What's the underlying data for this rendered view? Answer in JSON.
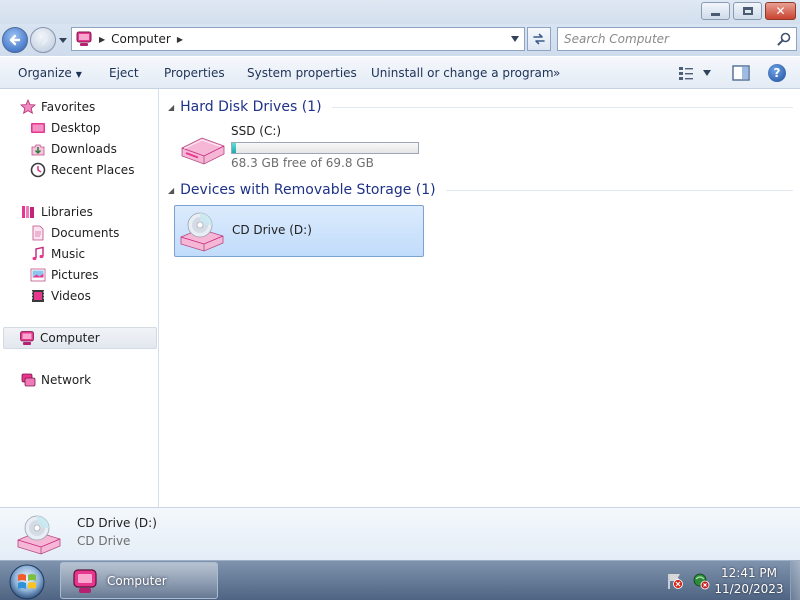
{
  "window": {
    "minimize": "minimize",
    "maximize": "restore",
    "close": "close"
  },
  "address": {
    "crumb": "Computer",
    "search_placeholder": "Search Computer"
  },
  "commands": {
    "organize": "Organize",
    "eject": "Eject",
    "properties": "Properties",
    "system_properties": "System properties",
    "uninstall": "Uninstall or change a program",
    "more": "»"
  },
  "nav": {
    "favorites": "Favorites",
    "desktop": "Desktop",
    "downloads": "Downloads",
    "recent_places": "Recent Places",
    "libraries": "Libraries",
    "documents": "Documents",
    "music": "Music",
    "pictures": "Pictures",
    "videos": "Videos",
    "computer": "Computer",
    "network": "Network"
  },
  "content": {
    "hdd_header": "Hard Disk Drives (1)",
    "removable_header": "Devices with Removable Storage (1)",
    "drive_c": {
      "name": "SSD (C:)",
      "free_text": "68.3 GB free of 69.8 GB",
      "used_fraction": 0.0215
    },
    "drive_d": {
      "name": "CD Drive (D:)"
    }
  },
  "details": {
    "name": "CD Drive (D:)",
    "type": "CD Drive"
  },
  "taskbar": {
    "window_button": "Computer",
    "time": "12:41 PM",
    "date": "11/20/2023"
  },
  "colors": {
    "accent_pink": "#e8368f",
    "selection_blue": "#c1dcfb",
    "progress_fill": "#1ba9b0"
  }
}
